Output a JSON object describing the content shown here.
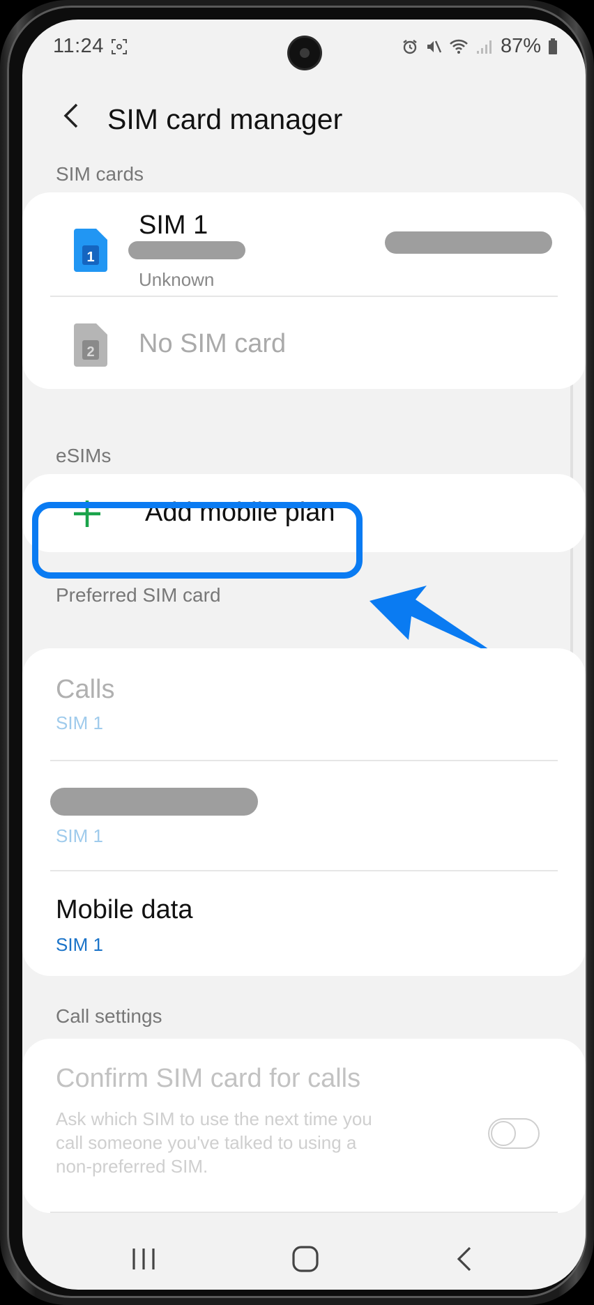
{
  "status_bar": {
    "time": "11:24",
    "battery": "87%",
    "icons": [
      "screenshot-icon",
      "alarm-icon",
      "mute-icon",
      "wifi-icon",
      "signal-icon",
      "battery-icon"
    ]
  },
  "header": {
    "title": "SIM card manager"
  },
  "sim_cards": {
    "section_label": "SIM cards",
    "sim1": {
      "name": "SIM 1",
      "status": "Unknown",
      "icon_number": "1"
    },
    "sim2": {
      "name": "No SIM card",
      "icon_number": "2"
    }
  },
  "esims": {
    "section_label": "eSIMs",
    "add_label": "Add mobile plan"
  },
  "preferred": {
    "section_label": "Preferred SIM card",
    "calls": {
      "title": "Calls",
      "value": "SIM 1"
    },
    "messages": {
      "value": "SIM 1"
    },
    "mobile_data": {
      "title": "Mobile data",
      "value": "SIM 1"
    }
  },
  "call_settings": {
    "section_label": "Call settings",
    "confirm": {
      "title": "Confirm SIM card for calls",
      "description_line1": "Ask which SIM to use the next time you",
      "description_line2": "call someone you've talked to using a",
      "description_line3": "non-preferred SIM."
    }
  },
  "colors": {
    "accent_blue": "#0a7bf2",
    "plus_green": "#1aa34a",
    "sim1_blue": "#2196f3",
    "link_blue": "#1a73c8"
  }
}
